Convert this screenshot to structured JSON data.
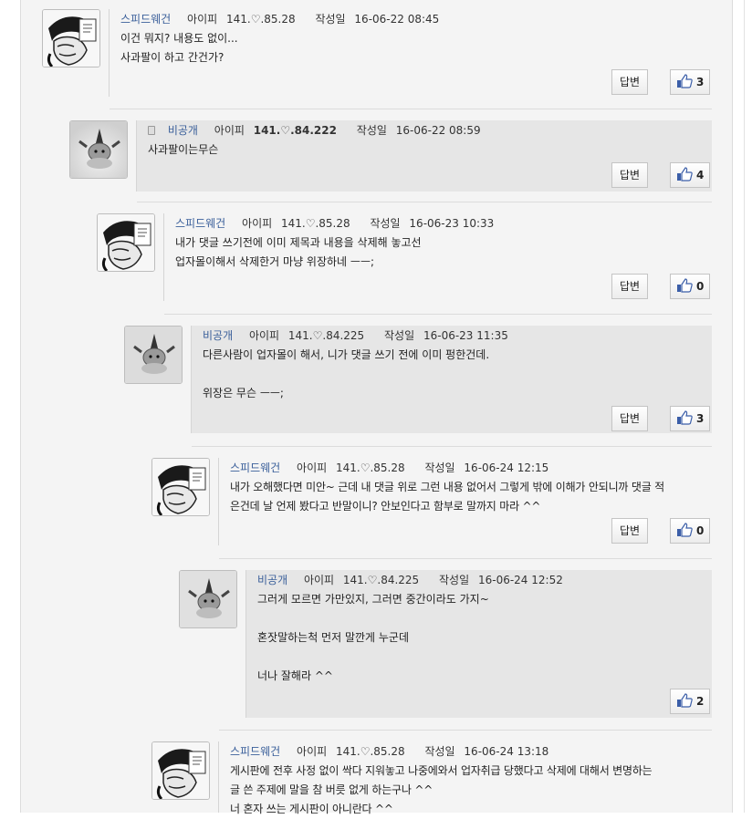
{
  "labels": {
    "ip_label": "아이피",
    "date_label": "작성일",
    "reply": "답변"
  },
  "comments": [
    {
      "nick": "스피드웨건",
      "ip": "141.♡.85.28",
      "date": "16-06-22 08:45",
      "lines": [
        "이건 뭐지? 내용도 없이...",
        "사과팔이 하고 간건가?"
      ],
      "likes": "3"
    },
    {
      "nick": "비공개",
      "ip": "141.♡.84.222",
      "date": "16-06-22 08:59",
      "lines": [
        "사과팔이는무슨"
      ],
      "likes": "4"
    },
    {
      "nick": "스피드웨건",
      "ip": "141.♡.85.28",
      "date": "16-06-23 10:33",
      "lines": [
        "내가 댓글 쓰기전에 이미 제목과 내용을 삭제해 놓고선",
        "업자몰이해서 삭제한거 마냥 위장하네 ㅡㅡ;"
      ],
      "likes": "0"
    },
    {
      "nick": "비공개",
      "ip": "141.♡.84.225",
      "date": "16-06-23 11:35",
      "lines": [
        "다른사람이 업자몰이 해서, 니가 댓글 쓰기 전에 이미 펑한건데.",
        "",
        "위장은 무슨 ㅡㅡ;"
      ],
      "likes": "3"
    },
    {
      "nick": "스피드웨건",
      "ip": "141.♡.85.28",
      "date": "16-06-24 12:15",
      "lines": [
        "내가 오해했다면 미안~ 근데 내 댓글 위로 그런 내용 없어서 그렇게 밖에 이해가 안되니까 댓글 적",
        "은건데 날 언제 봤다고 반말이니? 안보인다고 함부로 말까지 마라 ^^"
      ],
      "likes": "0"
    },
    {
      "nick": "비공개",
      "ip": "141.♡.84.225",
      "date": "16-06-24 12:52",
      "lines": [
        "그러게 모르면 가만있지, 그러면 중간이라도 가지~",
        "",
        "혼잣말하는척 먼저 말깐게 누군데",
        "",
        "너나 잘해라 ^^"
      ],
      "likes": "2"
    },
    {
      "nick": "스피드웨건",
      "ip": "141.♡.85.28",
      "date": "16-06-24 13:18",
      "lines": [
        "게시판에 전후 사정 없이 싹다 지워놓고 나중에와서 업자취급 당했다고 삭제에 대해서 변명하는",
        "글 쓴 주제에 말을 참 버릇 없게 하는구나 ^^",
        "너 혼자 쓰는 게시판이 아니란다 ^^"
      ],
      "likes": ""
    }
  ]
}
